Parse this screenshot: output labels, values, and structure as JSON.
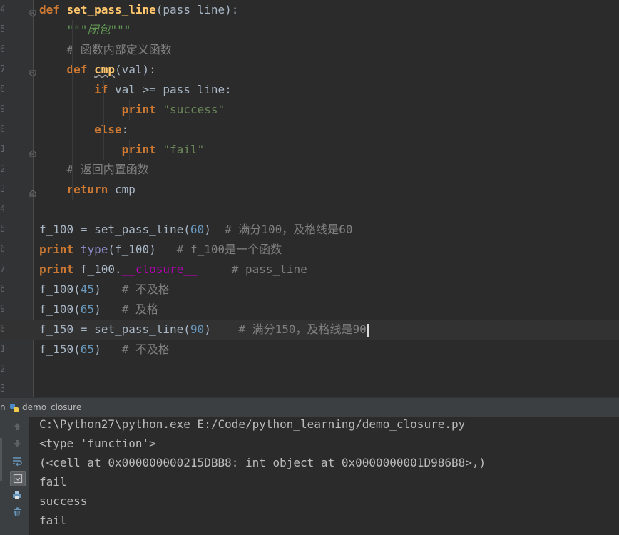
{
  "editor": {
    "line_numbers": [
      "4",
      "5",
      "6",
      "7",
      "8",
      "9",
      "0",
      "1",
      "2",
      "3",
      "4",
      "5",
      "6",
      "7",
      "8",
      "9",
      "0",
      "1",
      "2",
      "3"
    ],
    "lines": [
      {
        "indent": "",
        "parts": [
          {
            "t": "def",
            "c": "kw"
          },
          {
            "t": " ",
            "c": ""
          },
          {
            "t": "set_pass_line",
            "c": "fn"
          },
          {
            "t": "(pass_line):",
            "c": ""
          }
        ]
      },
      {
        "indent": "    ",
        "parts": [
          {
            "t": "\"\"\"",
            "c": "doc"
          },
          {
            "t": "闭包",
            "c": "doc"
          },
          {
            "t": "\"\"\"",
            "c": "doc"
          }
        ]
      },
      {
        "indent": "    ",
        "parts": [
          {
            "t": "# 函数内部定义函数",
            "c": "cm"
          }
        ]
      },
      {
        "indent": "    ",
        "parts": [
          {
            "t": "def",
            "c": "kw"
          },
          {
            "t": " ",
            "c": ""
          },
          {
            "t": "cmp",
            "c": "fn warn"
          },
          {
            "t": "(val):",
            "c": ""
          }
        ]
      },
      {
        "indent": "        ",
        "parts": [
          {
            "t": "if",
            "c": "kw"
          },
          {
            "t": " val >= pass_line:",
            "c": ""
          }
        ]
      },
      {
        "indent": "            ",
        "parts": [
          {
            "t": "print",
            "c": "kw"
          },
          {
            "t": " ",
            "c": ""
          },
          {
            "t": "\"success\"",
            "c": "str"
          }
        ]
      },
      {
        "indent": "        ",
        "parts": [
          {
            "t": "else",
            "c": "kw"
          },
          {
            "t": ":",
            "c": ""
          }
        ]
      },
      {
        "indent": "            ",
        "parts": [
          {
            "t": "print",
            "c": "kw"
          },
          {
            "t": " ",
            "c": ""
          },
          {
            "t": "\"fail\"",
            "c": "str"
          }
        ]
      },
      {
        "indent": "    ",
        "parts": [
          {
            "t": "# 返回内置函数",
            "c": "cm"
          }
        ]
      },
      {
        "indent": "    ",
        "parts": [
          {
            "t": "return",
            "c": "kw"
          },
          {
            "t": " cmp",
            "c": ""
          }
        ]
      },
      {
        "indent": "",
        "parts": []
      },
      {
        "indent": "",
        "parts": [
          {
            "t": "f_100 = set_pass_line(",
            "c": ""
          },
          {
            "t": "60",
            "c": "num"
          },
          {
            "t": ")  ",
            "c": ""
          },
          {
            "t": "# 满分100，及格线是60",
            "c": "cm"
          }
        ]
      },
      {
        "indent": "",
        "parts": [
          {
            "t": "print",
            "c": "kw"
          },
          {
            "t": " ",
            "c": ""
          },
          {
            "t": "type",
            "c": "bi"
          },
          {
            "t": "(f_100)   ",
            "c": ""
          },
          {
            "t": "# f_100是一个函数",
            "c": "cm"
          }
        ]
      },
      {
        "indent": "",
        "parts": [
          {
            "t": "print",
            "c": "kw"
          },
          {
            "t": " f_100.",
            "c": ""
          },
          {
            "t": "__closure__",
            "c": "magic"
          },
          {
            "t": "     ",
            "c": ""
          },
          {
            "t": "# pass_line",
            "c": "cm"
          }
        ]
      },
      {
        "indent": "",
        "parts": [
          {
            "t": "f_100(",
            "c": ""
          },
          {
            "t": "45",
            "c": "num"
          },
          {
            "t": ")   ",
            "c": ""
          },
          {
            "t": "# 不及格",
            "c": "cm"
          }
        ]
      },
      {
        "indent": "",
        "parts": [
          {
            "t": "f_100(",
            "c": ""
          },
          {
            "t": "65",
            "c": "num"
          },
          {
            "t": ")   ",
            "c": ""
          },
          {
            "t": "# 及格",
            "c": "cm"
          }
        ]
      },
      {
        "indent": "",
        "parts": [
          {
            "t": "f_150 = set_pass_line(",
            "c": ""
          },
          {
            "t": "90",
            "c": "num"
          },
          {
            "t": ")    ",
            "c": ""
          },
          {
            "t": "# 满分150，及格线是90",
            "c": "cm"
          }
        ],
        "current": true
      },
      {
        "indent": "",
        "parts": [
          {
            "t": "f_150(",
            "c": ""
          },
          {
            "t": "65",
            "c": "num"
          },
          {
            "t": ")   ",
            "c": ""
          },
          {
            "t": "# 不及格",
            "c": "cm"
          }
        ]
      },
      {
        "indent": "",
        "parts": []
      },
      {
        "indent": "",
        "parts": []
      }
    ]
  },
  "run_panel": {
    "label": "n",
    "tab_title": "demo_closure",
    "tool_icons": [
      "up-arrow-icon",
      "down-arrow-icon",
      "soft-wrap-icon",
      "scroll-to-end-icon",
      "print-icon",
      "trash-icon"
    ]
  },
  "console": {
    "lines": [
      "C:\\Python27\\python.exe E:/Code/python_learning/demo_closure.py",
      "<type 'function'>",
      "(<cell at 0x000000000215DBB8: int object at 0x0000000001D986B8>,)",
      "fail",
      "success",
      "fail"
    ]
  },
  "colors": {
    "editor_bg": "#2b2b2b",
    "gutter_bg": "#313335",
    "keyword": "#cc7832",
    "function": "#ffc66d",
    "string": "#6a8759",
    "comment": "#808080",
    "number": "#6897bb",
    "magic": "#b200b2"
  }
}
